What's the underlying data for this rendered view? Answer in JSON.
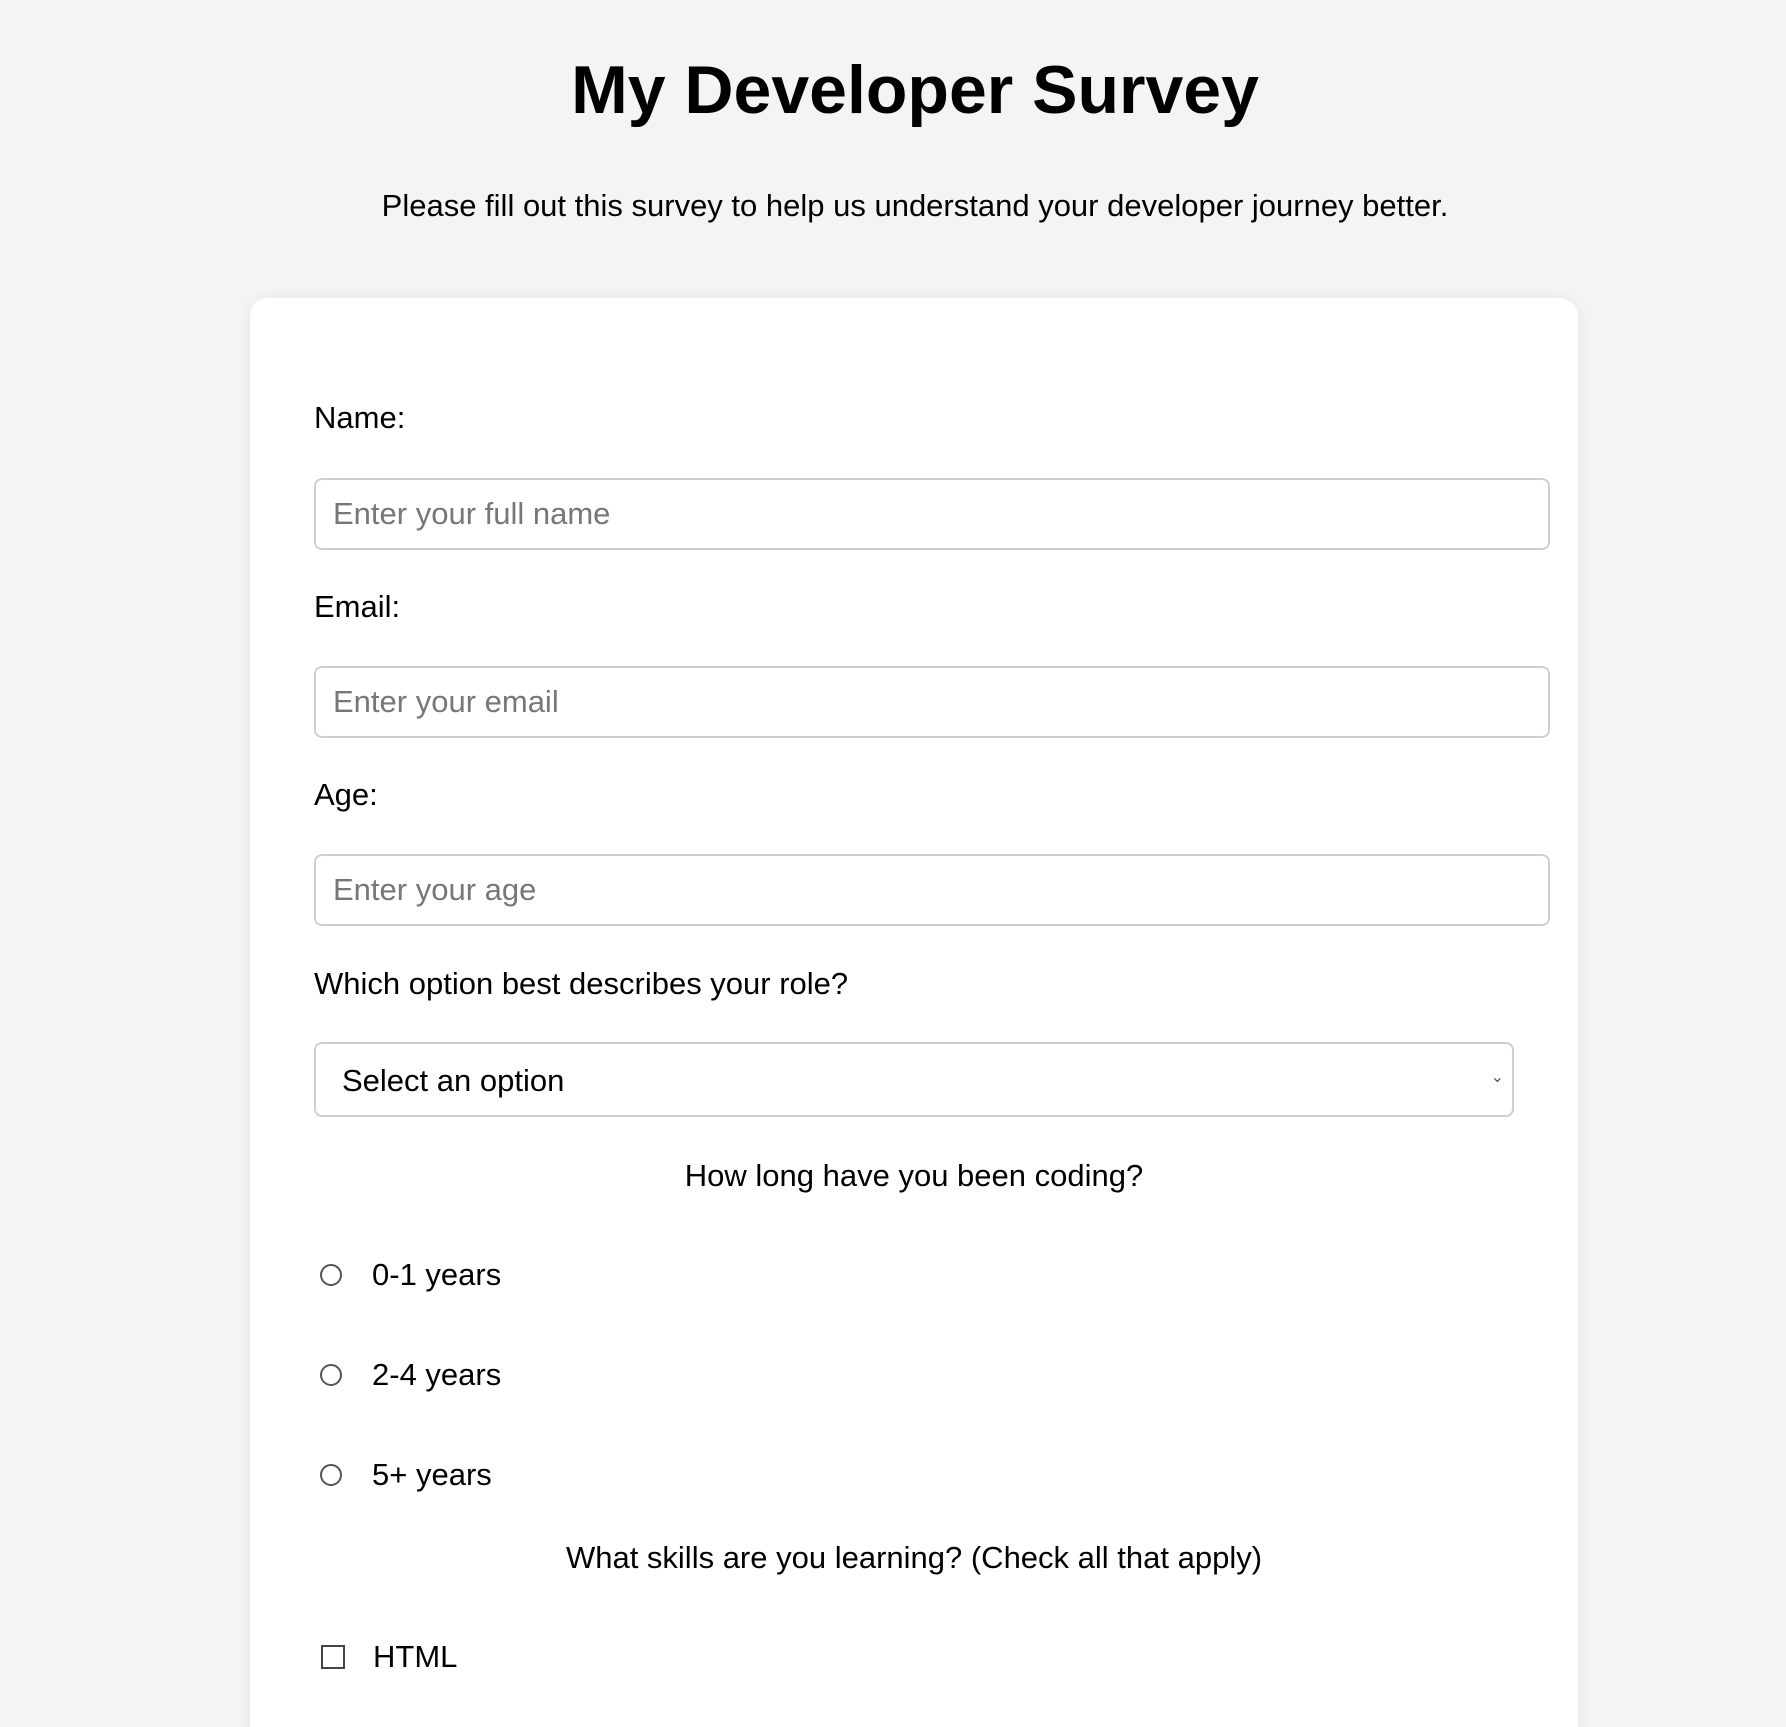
{
  "header": {
    "title": "My Developer Survey",
    "description": "Please fill out this survey to help us understand your developer journey better."
  },
  "form": {
    "name": {
      "label": "Name:",
      "placeholder": "Enter your full name",
      "value": ""
    },
    "email": {
      "label": "Email:",
      "placeholder": "Enter your email",
      "value": ""
    },
    "age": {
      "label": "Age:",
      "placeholder": "Enter your age",
      "value": ""
    },
    "role": {
      "label": "Which option best describes your role?",
      "selected": "Select an option",
      "chevron_icon": "chevron-down-icon"
    },
    "experience": {
      "question": "How long have you been coding?",
      "options": [
        {
          "label": "0-1 years",
          "checked": false
        },
        {
          "label": "2-4 years",
          "checked": false
        },
        {
          "label": "5+ years",
          "checked": false
        }
      ]
    },
    "skills": {
      "question": "What skills are you learning? (Check all that apply)",
      "options": [
        {
          "label": "HTML",
          "checked": false
        }
      ]
    }
  },
  "colors": {
    "background": "#f4f4f4",
    "card": "#ffffff",
    "input_border": "#cfcfcf",
    "placeholder": "#777777"
  }
}
